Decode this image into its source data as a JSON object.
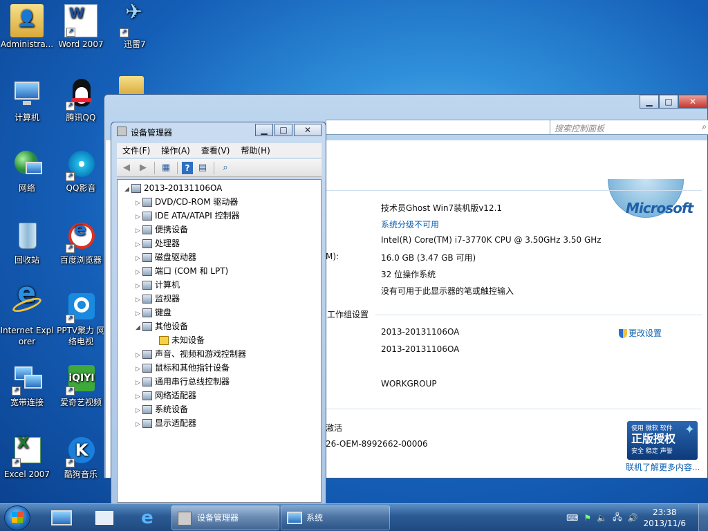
{
  "desktop": {
    "icons": [
      {
        "label": "Administra...",
        "glyph": "👤"
      },
      {
        "label": "Word 2007",
        "glyph": "W"
      },
      {
        "label": "迅雷7",
        "glyph": "✈"
      },
      {
        "label": "计算机",
        "glyph": "🖥"
      },
      {
        "label": "腾讯QQ",
        "glyph": "🐧"
      },
      {
        "label": "网络",
        "glyph": "🌐"
      },
      {
        "label": "QQ影音",
        "glyph": "▶"
      },
      {
        "label": "回收站",
        "glyph": "🗑"
      },
      {
        "label": "百度浏览器",
        "glyph": "e"
      },
      {
        "label": "Internet Explorer",
        "glyph": "e"
      },
      {
        "label": "PPTV聚力 网络电视",
        "glyph": "P"
      },
      {
        "label": "宽带连接",
        "glyph": "🖧"
      },
      {
        "label": "爱奇艺视频",
        "glyph": "i"
      },
      {
        "label": "Excel 2007",
        "glyph": "X"
      },
      {
        "label": "酷狗音乐",
        "glyph": "K"
      }
    ]
  },
  "system_window": {
    "search_placeholder": "搜索控制面板",
    "search_icon": "search-icon",
    "windows_edition": "技术员Ghost Win7装机版v12.1",
    "rating_link": "系统分级不可用",
    "processor": "Intel(R) Core(TM) i7-3770K CPU @ 3.50GHz   3.50 GHz",
    "memory_label": "M):",
    "memory": "16.0 GB (3.47 GB 可用)",
    "system_type": "32 位操作系统",
    "pen_touch": "没有可用于此显示器的笔或触控输入",
    "workgroup_heading": "工作组设置",
    "computer_name": "2013-20131106OA",
    "full_computer_name": "2013-20131106OA",
    "workgroup": "WORKGROUP",
    "change_settings": "更改设置",
    "activation_heading": "激活",
    "product_id": "26-OEM-8992662-00006",
    "learn_more": "联机了解更多内容...",
    "ms_logo": "Microsoft",
    "genuine_top": "使用 微软 软件",
    "genuine_main": "正版授权",
    "genuine_bottom": "安全 稳定 声誉"
  },
  "device_manager": {
    "title": "设备管理器",
    "menu": [
      "文件(F)",
      "操作(A)",
      "查看(V)",
      "帮助(H)"
    ],
    "root": "2013-20131106OA",
    "nodes": [
      {
        "label": "DVD/CD-ROM 驱动器",
        "expanded": false
      },
      {
        "label": "IDE ATA/ATAPI 控制器",
        "expanded": false
      },
      {
        "label": "便携设备",
        "expanded": false
      },
      {
        "label": "处理器",
        "expanded": false
      },
      {
        "label": "磁盘驱动器",
        "expanded": false
      },
      {
        "label": "端口 (COM 和 LPT)",
        "expanded": false
      },
      {
        "label": "计算机",
        "expanded": false
      },
      {
        "label": "监视器",
        "expanded": false
      },
      {
        "label": "键盘",
        "expanded": false
      },
      {
        "label": "其他设备",
        "expanded": true
      },
      {
        "label": "未知设备",
        "child": true,
        "warning": true
      },
      {
        "label": "声音、视频和游戏控制器",
        "expanded": false
      },
      {
        "label": "鼠标和其他指针设备",
        "expanded": false
      },
      {
        "label": "通用串行总线控制器",
        "expanded": false
      },
      {
        "label": "网络适配器",
        "expanded": false
      },
      {
        "label": "系统设备",
        "expanded": false
      },
      {
        "label": "显示适配器",
        "expanded": false
      }
    ]
  },
  "taskbar": {
    "items": [
      {
        "label": "设备管理器"
      },
      {
        "label": "系统"
      }
    ],
    "time": "23:38",
    "date": "2013/11/6"
  },
  "colors": {
    "link": "#0a5fb0",
    "taskbar": "#2b5a93",
    "desktop": "#155fb8"
  }
}
